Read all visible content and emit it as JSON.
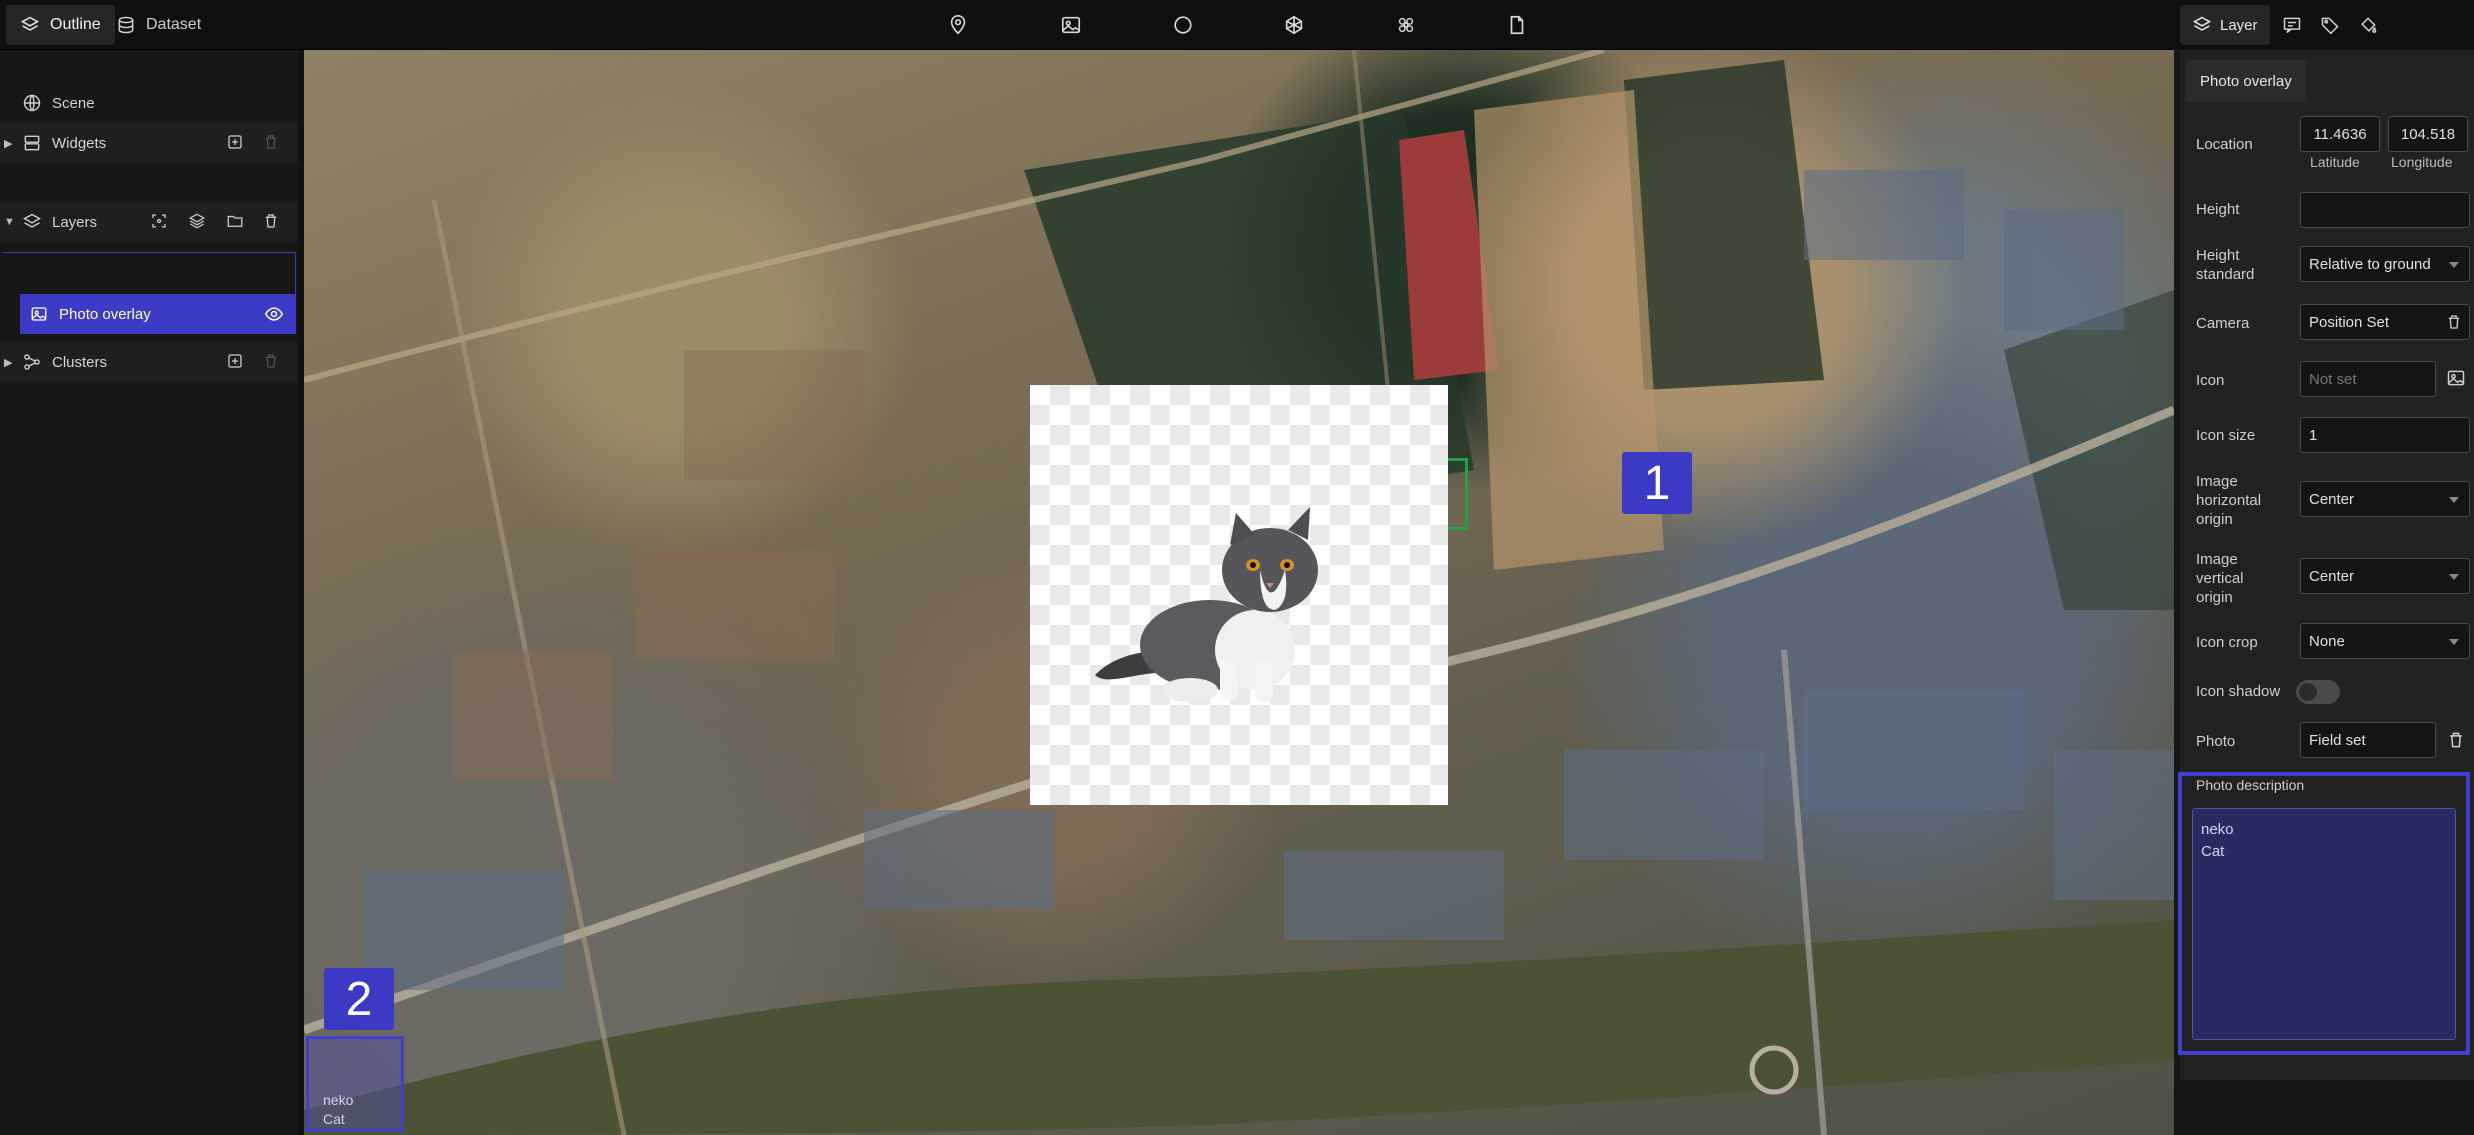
{
  "top_tabs": [
    {
      "label": "Outline",
      "icon": "layers-icon",
      "active": true
    },
    {
      "label": "Dataset",
      "icon": "database-icon",
      "active": false
    }
  ],
  "toolbar_icons": [
    "map-pin-icon",
    "image-icon",
    "circle-icon",
    "polygon-icon",
    "sphere-cluster-icon",
    "document-icon"
  ],
  "sidebar": {
    "scene": "Scene",
    "widgets": "Widgets",
    "layers": "Layers",
    "selected_layer": "Photo overlay",
    "clusters": "Clusters"
  },
  "map": {
    "badge_1": "1",
    "badge_2": "2",
    "popup_line1": "neko",
    "popup_line2": "Cat"
  },
  "right_panel": {
    "tabs": [
      {
        "label": "Layer",
        "icon": "layers-icon",
        "active": true
      }
    ],
    "extra_tab_icons": [
      "comment-icon",
      "tag-icon",
      "paint-bucket-icon"
    ],
    "subtab": "Photo overlay",
    "location": {
      "label": "Location",
      "latitude": "11.4636",
      "longitude": "104.518",
      "lat_caption": "Latitude",
      "lon_caption": "Longitude"
    },
    "height": {
      "label": "Height",
      "value": ""
    },
    "height_standard": {
      "label_line1": "Height",
      "label_line2": "standard",
      "value": "Relative to ground"
    },
    "camera": {
      "label": "Camera",
      "value": "Position Set"
    },
    "icon": {
      "label": "Icon",
      "placeholder": "Not set"
    },
    "icon_size": {
      "label": "Icon size",
      "value": "1"
    },
    "image_h_origin": {
      "label_line1": "Image",
      "label_line2": "horizontal",
      "label_line3": "origin",
      "value": "Center"
    },
    "image_v_origin": {
      "label_line1": "Image",
      "label_line2": "vertical",
      "label_line3": "origin",
      "value": "Center"
    },
    "icon_crop": {
      "label": "Icon crop",
      "value": "None"
    },
    "icon_shadow": {
      "label": "Icon shadow",
      "enabled": false
    },
    "photo": {
      "label": "Photo",
      "value": "Field set"
    },
    "photo_description": {
      "label": "Photo description",
      "value": "neko\nCat"
    }
  },
  "colors": {
    "accent": "#3b3bc6",
    "highlight_border": "#3f3fd0",
    "map_marker": "#23a043"
  }
}
